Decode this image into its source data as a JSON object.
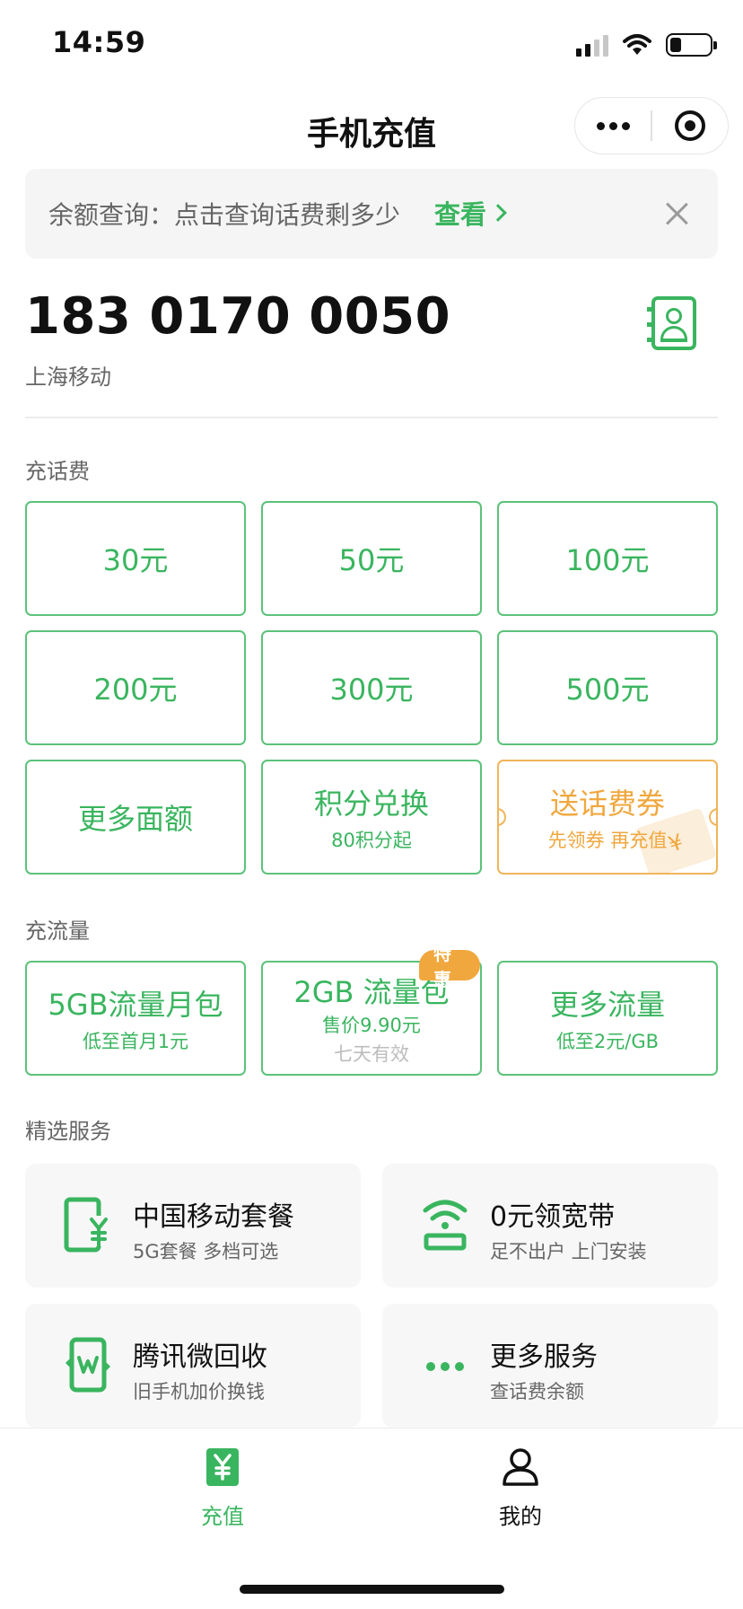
{
  "status_bar": {
    "time": "14:59"
  },
  "nav": {
    "title": "手机充值"
  },
  "banner": {
    "text": "余额查询：点击查询话费剩多少",
    "link_label": "查看"
  },
  "account": {
    "phone": "183 0170 0050",
    "carrier": "上海移动"
  },
  "recharge": {
    "section_title": "充话费",
    "options": [
      {
        "label": "30元"
      },
      {
        "label": "50元"
      },
      {
        "label": "100元"
      },
      {
        "label": "200元"
      },
      {
        "label": "300元"
      },
      {
        "label": "500元"
      },
      {
        "label": "更多面额"
      },
      {
        "label": "积分兑换",
        "sub": "80积分起"
      },
      {
        "label": "送话费券",
        "sub": "先领券 再充值"
      }
    ]
  },
  "data_plans": {
    "section_title": "充流量",
    "options": [
      {
        "label": "5GB流量月包",
        "sub": "低至首月1元"
      },
      {
        "label": "2GB 流量包",
        "sub": "售价9.90元",
        "sub2": "七天有效",
        "badge": "特惠"
      },
      {
        "label": "更多流量",
        "sub": "低至2元/GB"
      }
    ]
  },
  "services": {
    "section_title": "精选服务",
    "items": [
      {
        "title": "中国移动套餐",
        "sub": "5G套餐 多档可选",
        "icon": "phone-yuan-icon"
      },
      {
        "title": "0元领宽带",
        "sub": "足不出户 上门安装",
        "icon": "wifi-router-icon"
      },
      {
        "title": "腾讯微回收",
        "sub": "旧手机加价换钱",
        "icon": "phone-recycle-icon"
      },
      {
        "title": "更多服务",
        "sub": "查话费余额",
        "icon": "more-dots-icon"
      }
    ]
  },
  "tabbar": {
    "items": [
      {
        "label": "充值",
        "icon": "recharge-yuan-icon",
        "active": true
      },
      {
        "label": "我的",
        "icon": "user-icon",
        "active": false
      }
    ]
  },
  "colors": {
    "accent": "#3ab55f",
    "orange": "#f0a73d",
    "text_secondary": "#666666"
  }
}
